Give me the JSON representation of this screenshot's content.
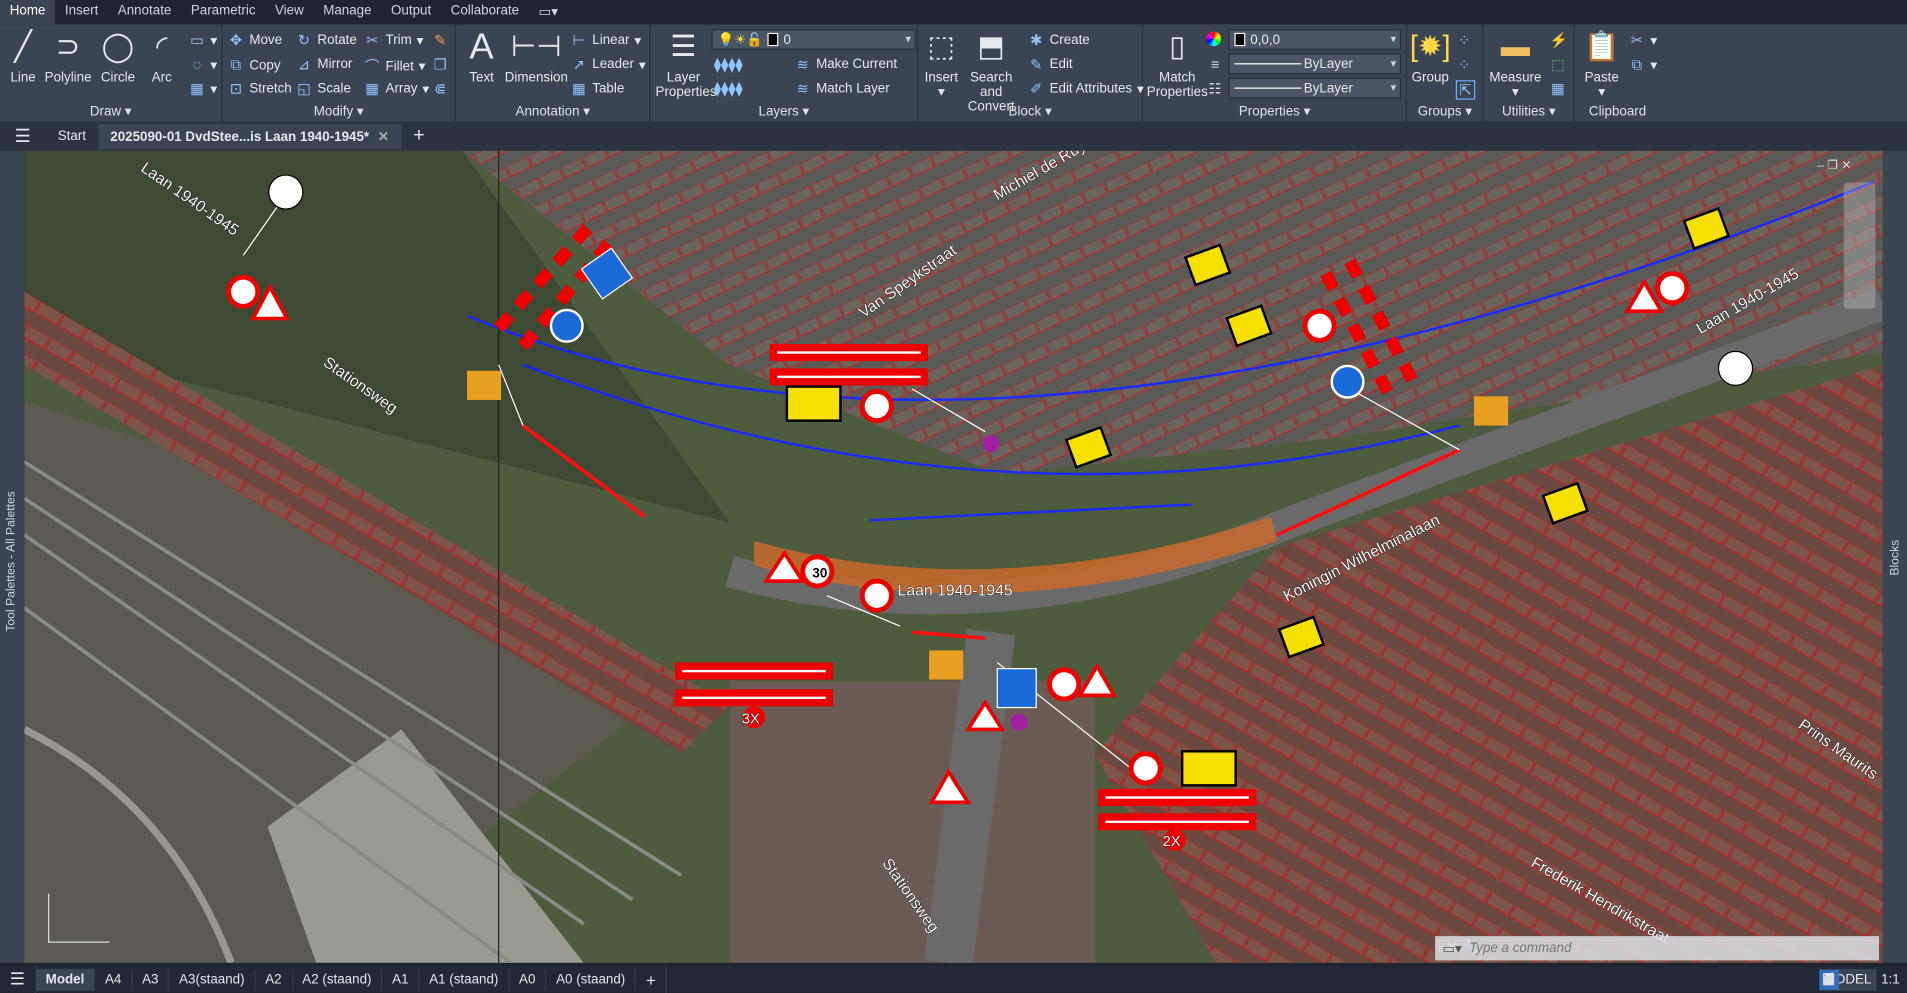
{
  "ribbon_tabs": [
    "Home",
    "Insert",
    "Annotate",
    "Parametric",
    "View",
    "Manage",
    "Output",
    "Collaborate"
  ],
  "panels": {
    "draw": {
      "title": "Draw",
      "line": "Line",
      "polyline": "Polyline",
      "circle": "Circle",
      "arc": "Arc"
    },
    "modify": {
      "title": "Modify",
      "move": "Move",
      "rotate": "Rotate",
      "trim": "Trim",
      "copy": "Copy",
      "mirror": "Mirror",
      "fillet": "Fillet",
      "stretch": "Stretch",
      "scale": "Scale",
      "array": "Array"
    },
    "annotation": {
      "title": "Annotation",
      "text": "Text",
      "dimension": "Dimension",
      "linear": "Linear",
      "leader": "Leader",
      "table": "Table"
    },
    "layers": {
      "title": "Layers",
      "layer_properties": "Layer Properties",
      "current_layer": "0",
      "make_current": "Make Current",
      "match_layer": "Match Layer"
    },
    "block": {
      "title": "Block",
      "insert": "Insert",
      "search_convert": "Search and Convert",
      "create": "Create",
      "edit": "Edit",
      "edit_attributes": "Edit Attributes"
    },
    "properties": {
      "title": "Properties",
      "match_properties": "Match Properties",
      "color": "0,0,0",
      "linetype": "ByLayer",
      "lineweight": "ByLayer"
    },
    "groups": {
      "title": "Groups",
      "group": "Group"
    },
    "utilities": {
      "title": "Utilities",
      "measure": "Measure"
    },
    "clipboard": {
      "title": "Clipboard",
      "paste": "Paste"
    }
  },
  "doc_tabs": {
    "start": "Start",
    "active": "2025090-01 DvdStee...is Laan 1940-1945*"
  },
  "palettes": {
    "left": "Tool Palettes - All Palettes",
    "right": "Blocks"
  },
  "map_labels": {
    "laan1": "Laan 1940-1945",
    "laan2": "Laan 1940-1945",
    "laan3": "Laan 1940-1945",
    "stationsweg1": "Stationsweg",
    "stationsweg2": "Stationsweg",
    "speijk": "Van Speykstraat",
    "michiel": "Michiel de Ruyter",
    "koningin": "Koningin Wilhelminalaan",
    "prins": "Prins Maurits",
    "frederik": "Frederik Hendrikstraat",
    "x3": "3X",
    "x2": "2X",
    "s30": "30"
  },
  "command": {
    "placeholder": "Type a command"
  },
  "layout_tabs": [
    "Model",
    "A4",
    "A3",
    "A3(staand)",
    "A2",
    "A2 (staand)",
    "A1",
    "A1 (staand)",
    "A0",
    "A0 (staand)"
  ],
  "status": {
    "model": "MODEL",
    "scale": "1:1"
  }
}
